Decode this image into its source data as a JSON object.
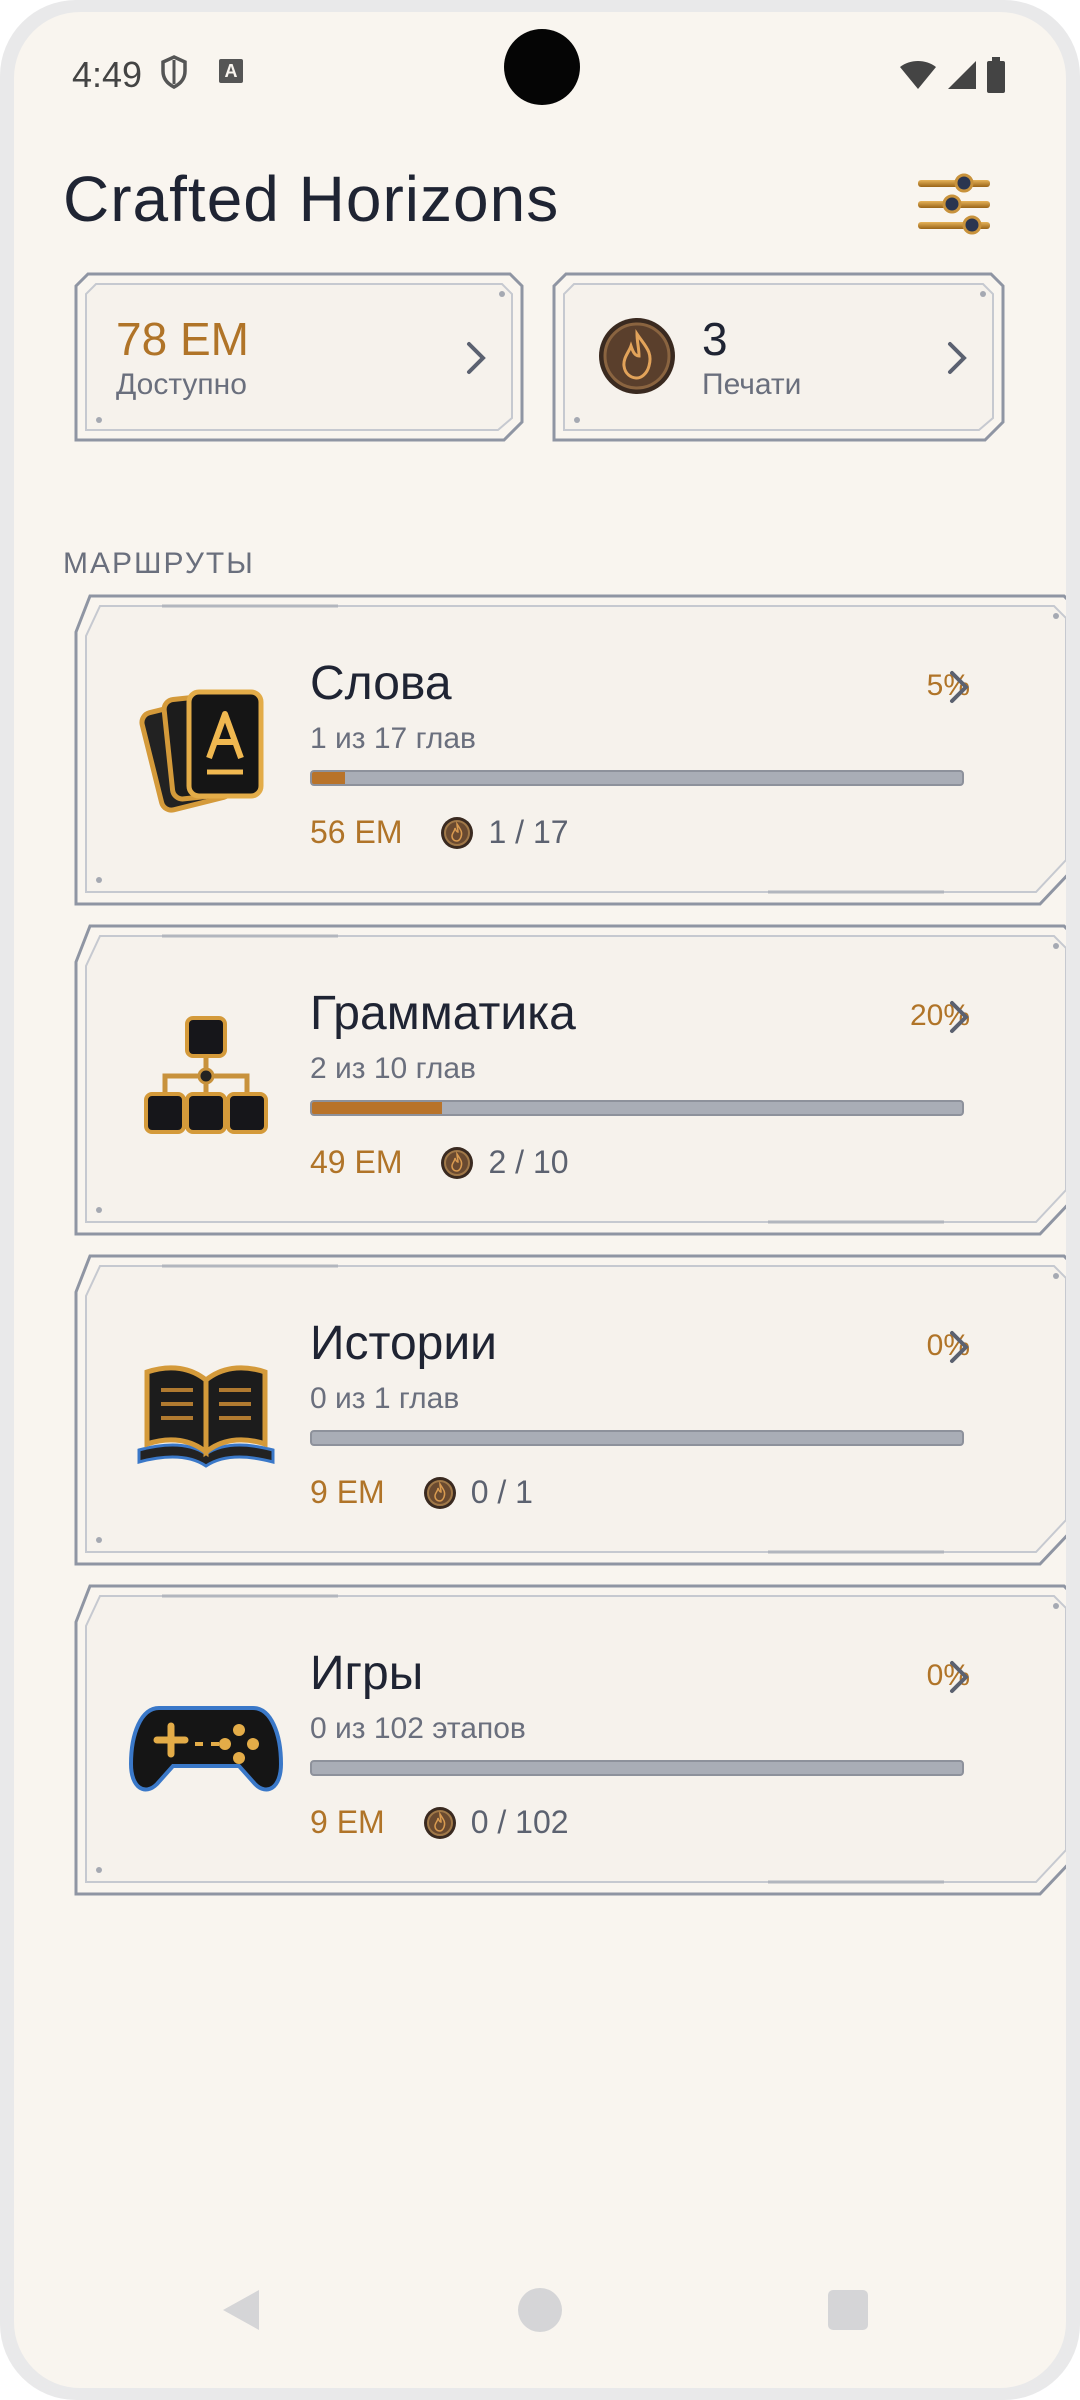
{
  "status_bar": {
    "time": "4:49"
  },
  "header": {
    "title": "Crafted Horizons"
  },
  "stats": {
    "em": {
      "value": "78 EM",
      "label": "Доступно"
    },
    "seals": {
      "value": "3",
      "label": "Печати"
    }
  },
  "section_title": "МАРШРУТЫ",
  "routes": [
    {
      "name": "Слова",
      "subtitle": "1 из 17 глав",
      "percent": "5%",
      "progress": 0.05,
      "em": "56 EM",
      "count": "1 / 17",
      "icon": "cards-icon"
    },
    {
      "name": "Грамматика",
      "subtitle": "2 из 10 глав",
      "percent": "20%",
      "progress": 0.2,
      "em": "49 EM",
      "count": "2 / 10",
      "icon": "hierarchy-icon"
    },
    {
      "name": "Истории",
      "subtitle": "0 из 1 глав",
      "percent": "0%",
      "progress": 0,
      "em": "9 EM",
      "count": "0 / 1",
      "icon": "book-icon"
    },
    {
      "name": "Игры",
      "subtitle": "0 из 102 этапов",
      "percent": "0%",
      "progress": 0,
      "em": "9 EM",
      "count": "0 / 102",
      "icon": "gamepad-icon"
    }
  ],
  "colors": {
    "accent": "#b8732a",
    "background": "#f9f5ef",
    "text": "#1f2433",
    "muted": "#6a6f7d"
  }
}
